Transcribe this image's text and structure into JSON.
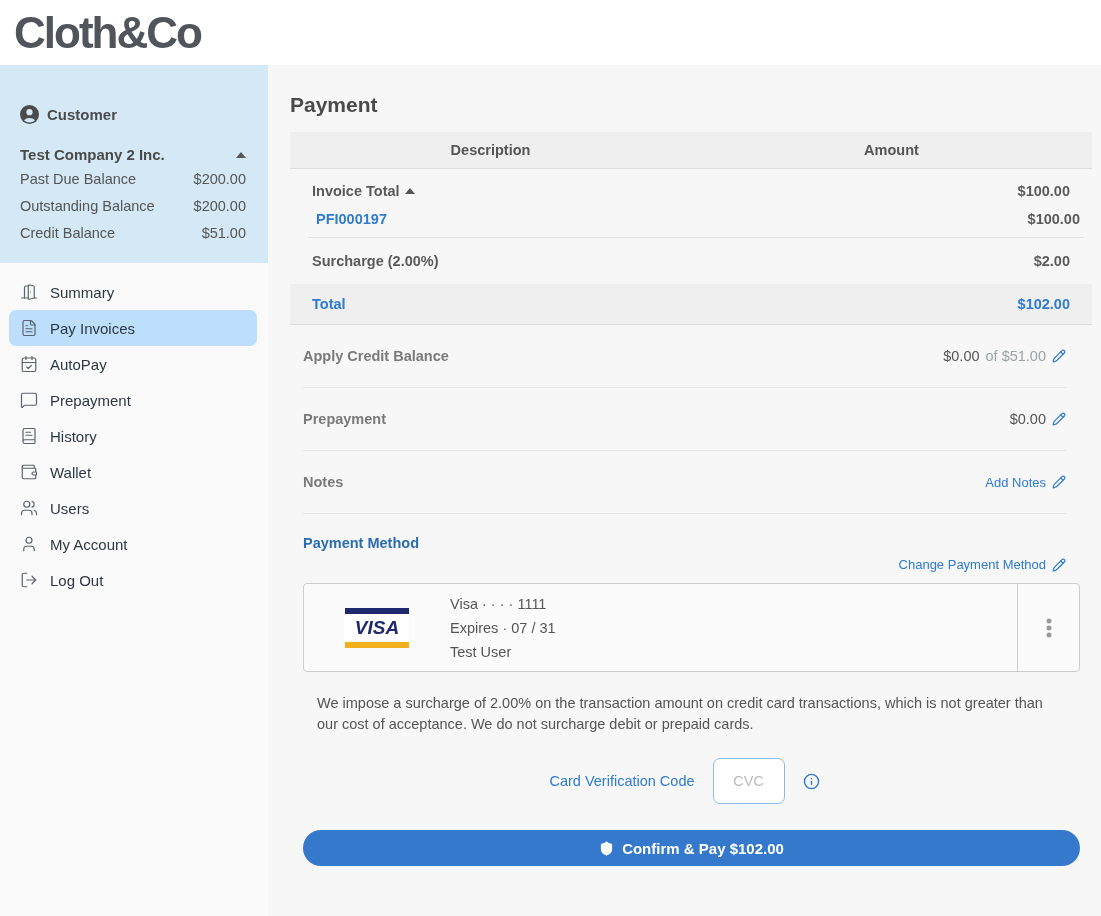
{
  "logo": "Cloth&Co",
  "customer": {
    "heading": "Customer",
    "company": "Test Company 2 Inc.",
    "expanded": true,
    "balances": [
      {
        "label": "Past Due Balance",
        "value": "$200.00"
      },
      {
        "label": "Outstanding Balance",
        "value": "$200.00"
      },
      {
        "label": "Credit Balance",
        "value": "$51.00"
      }
    ]
  },
  "nav": [
    {
      "label": "Summary",
      "selected": false
    },
    {
      "label": "Pay Invoices",
      "selected": true
    },
    {
      "label": "AutoPay",
      "selected": false
    },
    {
      "label": "Prepayment",
      "selected": false
    },
    {
      "label": "History",
      "selected": false
    },
    {
      "label": "Wallet",
      "selected": false
    },
    {
      "label": "Users",
      "selected": false
    },
    {
      "label": "My Account",
      "selected": false
    },
    {
      "label": "Log Out",
      "selected": false
    }
  ],
  "page_title": "Payment",
  "table": {
    "columns": [
      "Description",
      "Amount"
    ],
    "invoice_total": {
      "label": "Invoice Total",
      "amount": "$100.00",
      "expanded": true,
      "invoices": [
        {
          "number": "PFI000197",
          "amount": "$100.00"
        }
      ]
    },
    "surcharge": {
      "label": "Surcharge (2.00%)",
      "amount": "$2.00"
    },
    "total": {
      "label": "Total",
      "amount": "$102.00"
    }
  },
  "adjustments": [
    {
      "label": "Apply Credit Balance",
      "kind": "amount",
      "value": "$0.00",
      "of": "of $51.00"
    },
    {
      "label": "Prepayment",
      "kind": "amount",
      "value": "$0.00"
    },
    {
      "label": "Notes",
      "kind": "link",
      "value": "Add Notes"
    }
  ],
  "payment_method": {
    "heading": "Payment Method",
    "change_link": "Change Payment Method",
    "card": {
      "brand_logo": "VISA",
      "number": "Visa · · · · 1111",
      "expires": "Expires · 07 / 31",
      "holder": "Test User"
    }
  },
  "disclaimer": "We impose a surcharge of 2.00% on the transaction amount on credit card transactions, which is not greater than our cost of acceptance. We do not surcharge debit or prepaid cards.",
  "cvc": {
    "label": "Card Verification Code",
    "placeholder": "CVC"
  },
  "confirm_button": "Confirm & Pay $102.00"
}
